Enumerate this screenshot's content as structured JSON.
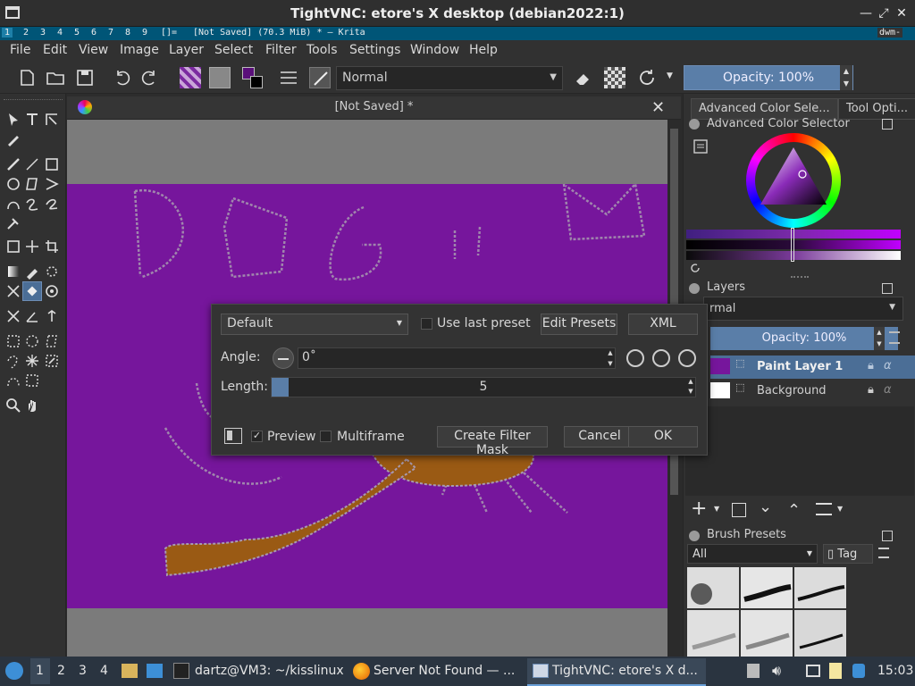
{
  "vnc": {
    "title": "TightVNC: etore's X desktop (debian2022:1)"
  },
  "dwm": {
    "tags": [
      "1",
      "2",
      "3",
      "4",
      "5",
      "6",
      "7",
      "8",
      "9"
    ],
    "layout": "[]=",
    "window_title": "[Not Saved]  (70.3 MiB)  * – Krita",
    "status": "dwm-"
  },
  "menu": [
    "File",
    "Edit",
    "View",
    "Image",
    "Layer",
    "Select",
    "Filter",
    "Tools",
    "Settings",
    "Window",
    "Help"
  ],
  "toolbar": {
    "blend_mode": "Normal",
    "opacity": "Opacity: 100%"
  },
  "document": {
    "title": "[Not Saved]  *"
  },
  "docker": {
    "tabs": [
      "Advanced Color Sele...",
      "Tool Opti..."
    ],
    "color_selector_title": "Advanced Color Selector",
    "layers_title": "Layers",
    "layer_mode": "rmal",
    "layer_opacity": "Opacity:  100%",
    "layers": [
      {
        "name": "Paint Layer 1",
        "selected": true
      },
      {
        "name": "Background",
        "selected": false
      }
    ],
    "brush_presets_title": "Brush Presets",
    "brush_filter": "All",
    "tag_label": "Tag"
  },
  "dialog": {
    "preset": "Default",
    "use_last_preset": "Use last preset",
    "edit_presets": "Edit Presets",
    "xml": "XML",
    "angle_label": "Angle:",
    "angle_value": "0˚",
    "length_label": "Length:",
    "length_value": "5",
    "length_fraction": 0.04,
    "preview": "Preview",
    "multiframe": "Multiframe",
    "create_filter_mask": "Create Filter Mask",
    "cancel": "Cancel",
    "ok": "OK"
  },
  "taskbar": {
    "workspaces": [
      "1",
      "2",
      "3",
      "4"
    ],
    "tasks": [
      "dartz@VM3: ~/kisslinux",
      "Server Not Found — ...",
      "TightVNC: etore's X d..."
    ],
    "clock": "15:03"
  },
  "colors": {
    "canvas_purple": "#76169c",
    "accent": "#5a7ea8",
    "dwm_bar": "#005577"
  }
}
